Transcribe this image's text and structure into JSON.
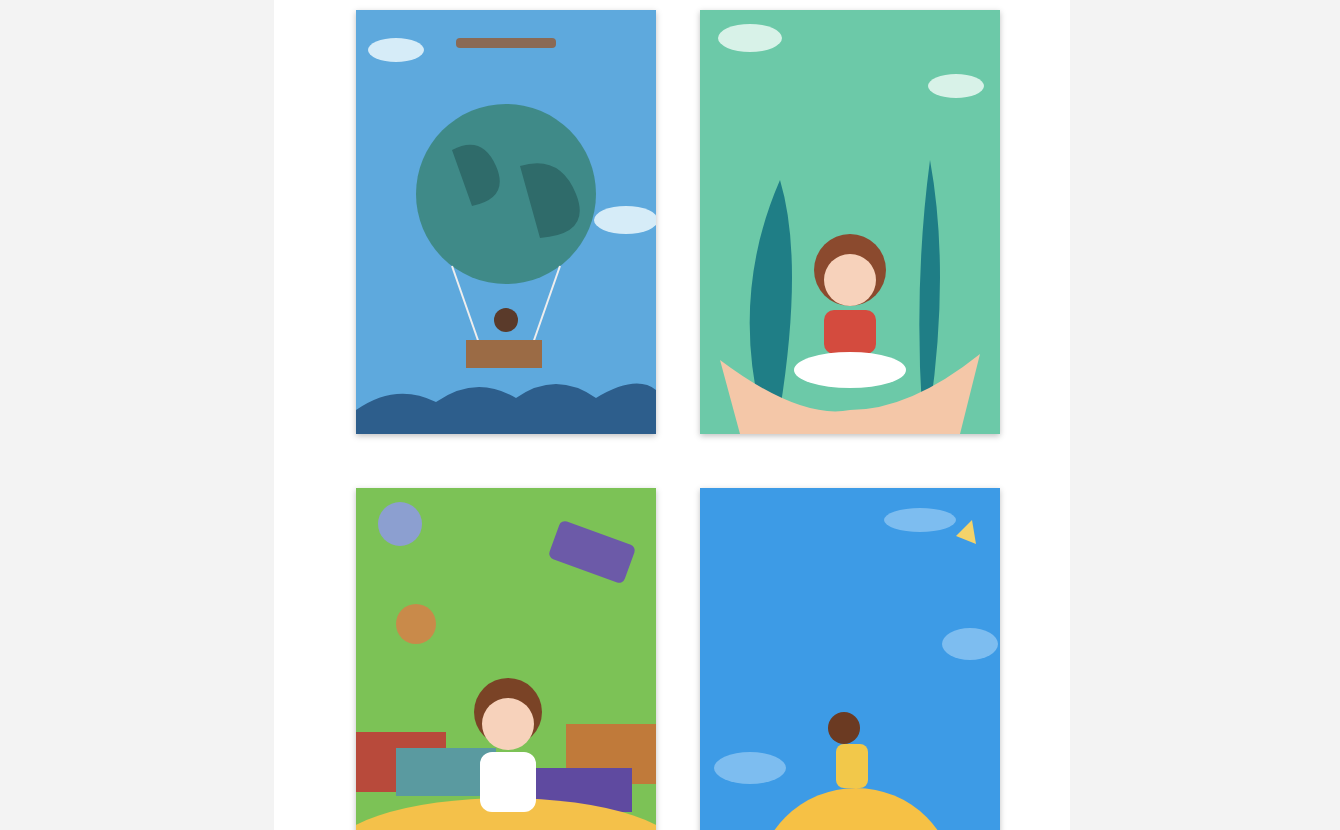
{
  "covers": [
    {
      "kind": "balloon",
      "color": "#5ea9dd"
    },
    {
      "kind": "hands",
      "color": "#6cc9a8"
    },
    {
      "kind": "room",
      "color": "#7cc256"
    },
    {
      "kind": "moon",
      "color": "#3d9be6"
    }
  ]
}
